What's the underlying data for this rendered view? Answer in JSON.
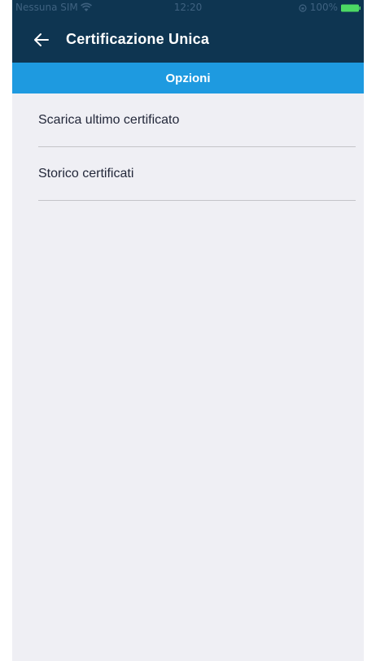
{
  "status_bar": {
    "carrier": "Nessuna SIM",
    "time": "12:20",
    "battery": "100%",
    "battery_color": "#4cd964"
  },
  "nav": {
    "title": "Certificazione Unica",
    "back_icon": "arrow-left-icon"
  },
  "section": {
    "title": "Opzioni"
  },
  "menu": {
    "items": [
      {
        "label": "Scarica ultimo certificato"
      },
      {
        "label": "Storico certificati"
      }
    ]
  },
  "colors": {
    "header": "#0e3551",
    "accent": "#1e9ae0",
    "background": "#efeff4"
  }
}
